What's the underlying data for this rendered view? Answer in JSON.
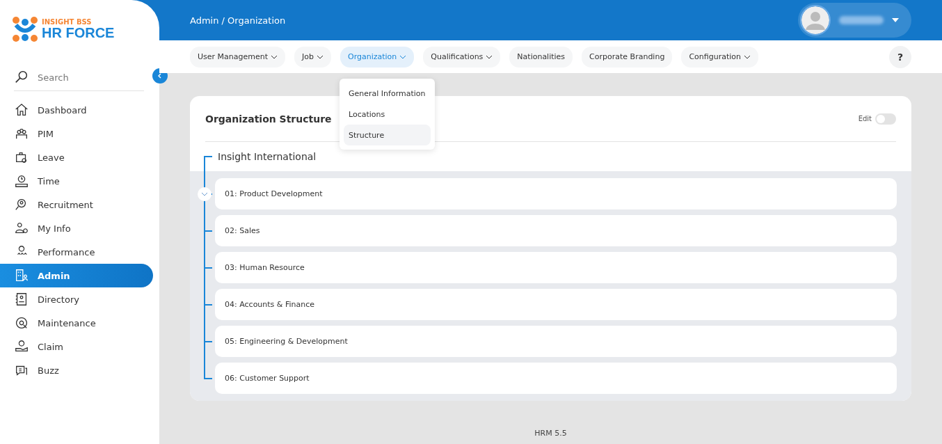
{
  "logo": {
    "tagline": "INSIGHT BSS",
    "name": "HR FORCE"
  },
  "sidebar": {
    "search": {
      "placeholder": "Search"
    },
    "items": [
      {
        "label": "Dashboard",
        "selected": false
      },
      {
        "label": "PIM",
        "selected": false
      },
      {
        "label": "Leave",
        "selected": false
      },
      {
        "label": "Time",
        "selected": false
      },
      {
        "label": "Recruitment",
        "selected": false
      },
      {
        "label": "My Info",
        "selected": false
      },
      {
        "label": "Performance",
        "selected": false
      },
      {
        "label": "Admin",
        "selected": true
      },
      {
        "label": "Directory",
        "selected": false
      },
      {
        "label": "Maintenance",
        "selected": false
      },
      {
        "label": "Claim",
        "selected": false
      },
      {
        "label": "Buzz",
        "selected": false
      }
    ]
  },
  "header": {
    "breadcrumb": "Admin / Organization"
  },
  "nav": [
    {
      "label": "User Management",
      "has_menu": true,
      "selected": false
    },
    {
      "label": "Job",
      "has_menu": true,
      "selected": false
    },
    {
      "label": "Organization",
      "has_menu": true,
      "selected": true
    },
    {
      "label": "Qualifications",
      "has_menu": true,
      "selected": false
    },
    {
      "label": "Nationalities",
      "has_menu": false,
      "selected": false
    },
    {
      "label": "Corporate Branding",
      "has_menu": false,
      "selected": false
    },
    {
      "label": "Configuration",
      "has_menu": true,
      "selected": false
    }
  ],
  "help_button": "?",
  "dropdown": [
    {
      "label": "General Information",
      "selected": false
    },
    {
      "label": "Locations",
      "selected": false
    },
    {
      "label": "Structure",
      "selected": true
    }
  ],
  "card": {
    "title": "Organization Structure",
    "edit": {
      "label": "Edit",
      "on": false
    },
    "tree": {
      "label": "Insight International",
      "expanded": true,
      "children": [
        {
          "label": "01: Product Development",
          "expanded": false
        },
        {
          "label": "02: Sales"
        },
        {
          "label": "03: Human Resource"
        },
        {
          "label": "04: Accounts & Finance"
        },
        {
          "label": "05: Engineering & Development"
        },
        {
          "label": "06: Customer Support"
        }
      ]
    }
  },
  "footer": "HRM 5.5"
}
